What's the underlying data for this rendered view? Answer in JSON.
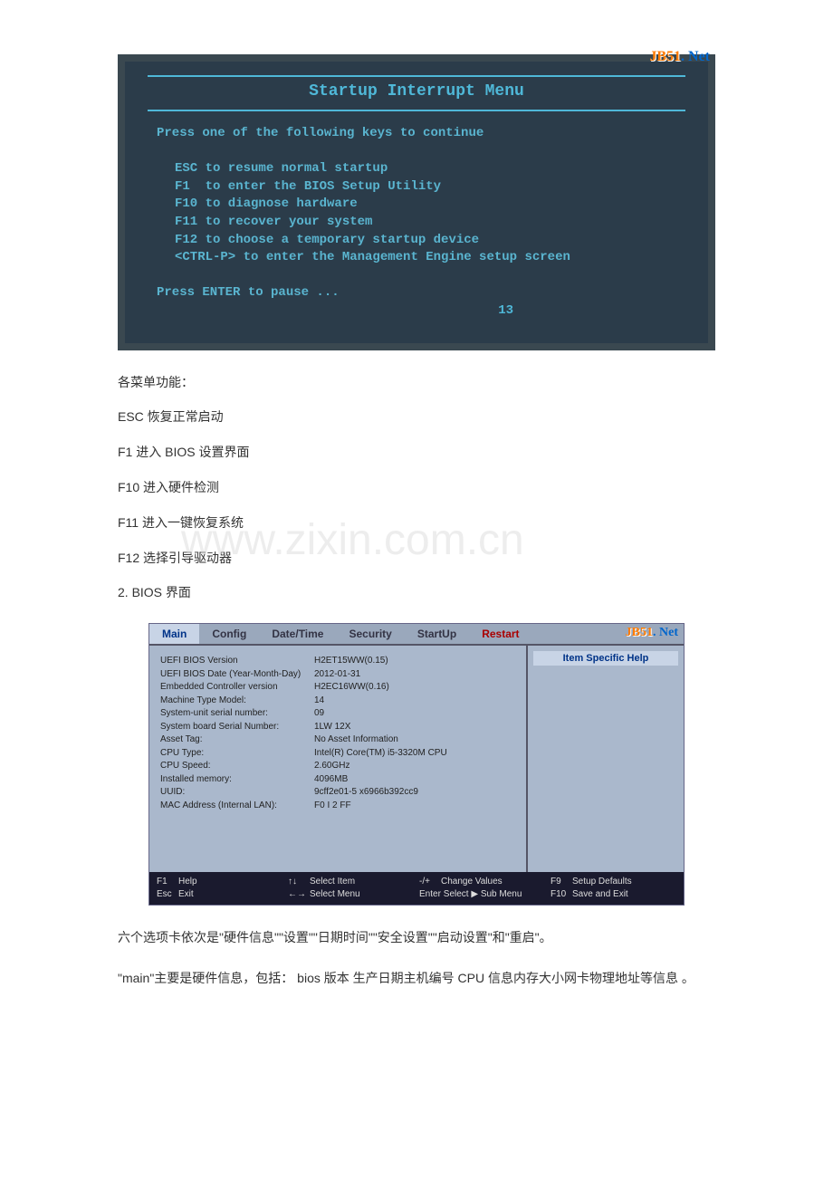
{
  "screenshot1": {
    "watermark_brand": "JB51",
    "watermark_suffix": ". Net",
    "title": "Startup Interrupt Menu",
    "prompt": "Press one of the following keys to continue",
    "options": [
      "ESC to resume normal startup",
      "F1  to enter the BIOS Setup Utility",
      "F10 to diagnose hardware",
      "F11 to recover your system",
      "F12 to choose a temporary startup device",
      "<CTRL-P> to enter the Management Engine setup screen"
    ],
    "pause": "Press ENTER to pause ...",
    "timer": "13"
  },
  "desc1": {
    "title": "各菜单功能：",
    "lines": [
      "ESC 恢复正常启动",
      "F1 进入 BIOS 设置界面",
      "F10 进入硬件检测",
      "F11 进入一键恢复系统",
      "F12 选择引导驱动器",
      "2. BIOS 界面"
    ]
  },
  "watermark_text": "www.zixin.com.cn",
  "bios": {
    "tabs": [
      "Main",
      "Config",
      "Date/Time",
      "Security",
      "StartUp",
      "Restart"
    ],
    "help_title": "Item Specific Help",
    "rows": [
      {
        "label": "UEFI BIOS Version",
        "value": "H2ET15WW(0.15)"
      },
      {
        "label": "UEFI BIOS Date (Year-Month-Day)",
        "value": "2012-01-31"
      },
      {
        "label": "Embedded Controller version",
        "value": "H2EC16WW(0.16)"
      },
      {
        "label": "Machine Type Model:",
        "value": "14"
      },
      {
        "label": "System-unit serial number:",
        "value": "09"
      },
      {
        "label": "System board Serial Number:",
        "value": "1LW      12X"
      },
      {
        "label": "Asset Tag:",
        "value": "No Asset Information"
      },
      {
        "label": "CPU Type:",
        "value": "Intel(R) Core(TM) i5-3320M CPU"
      },
      {
        "label": "CPU Speed:",
        "value": "2.60GHz"
      },
      {
        "label": "Installed memory:",
        "value": "4096MB"
      },
      {
        "label": "UUID:",
        "value": "9cff2e01-5                    x6966b392cc9"
      },
      {
        "label": "MAC Address (Internal LAN):",
        "value": "F0 I          2 FF"
      }
    ],
    "footer": {
      "f1": "Help",
      "esc": "Exit",
      "arrows_v": "↑↓",
      "arrows_h": "←→",
      "select_item": "Select Item",
      "select_menu": "Select Menu",
      "plusminus": "-/+",
      "enter": "Enter",
      "change_values": "Change Values",
      "sub_menu": "Select ▶ Sub Menu",
      "f9": "Setup Defaults",
      "f10": "Save and Exit"
    }
  },
  "desc2": {
    "line1": "六个选项卡依次是\"硬件信息\"\"设置\"\"日期时间\"\"安全设置\"\"启动设置\"和\"重启\"。",
    "line2": "\"main\"主要是硬件信息，包括： bios 版本 生产日期主机编号 CPU 信息内存大小网卡物理地址等信息 。"
  }
}
